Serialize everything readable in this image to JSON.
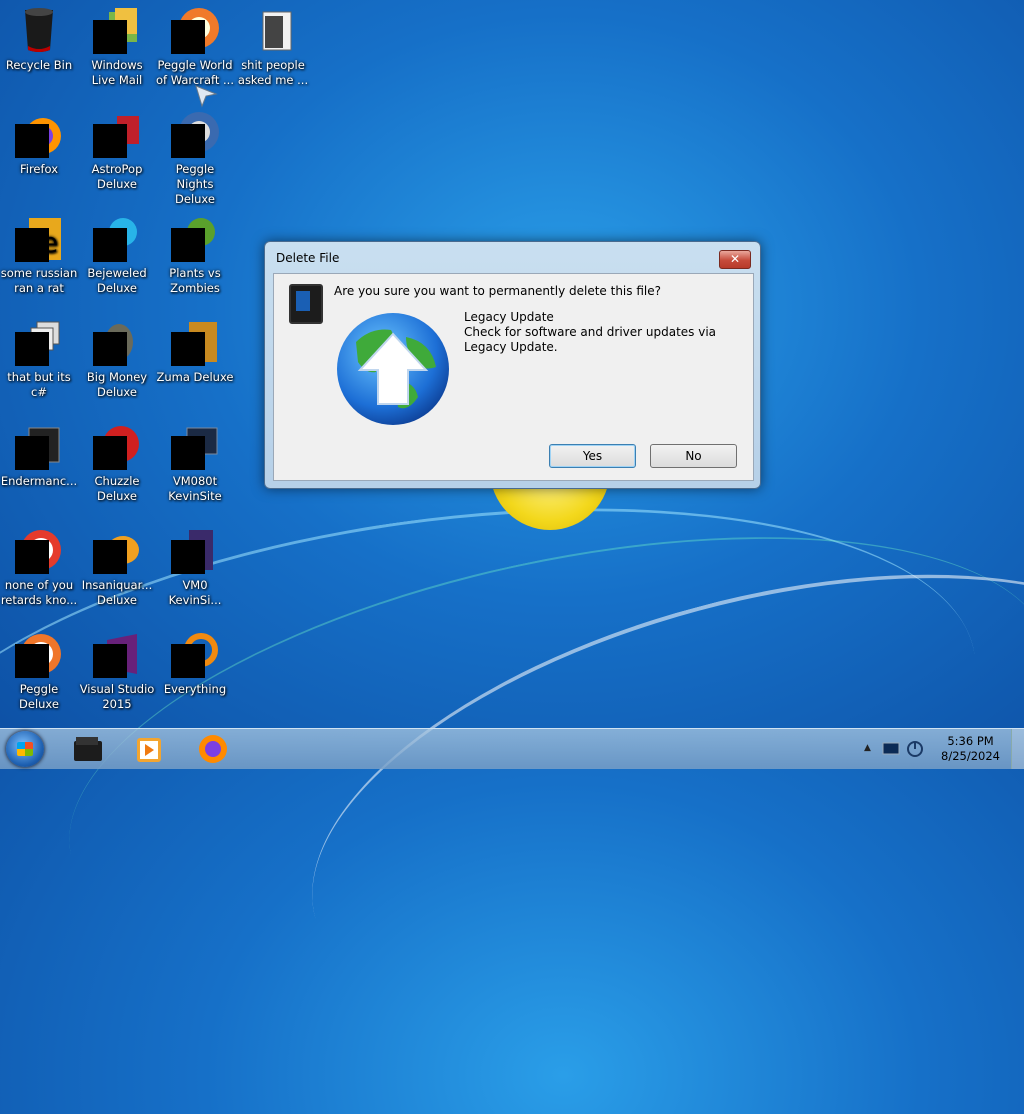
{
  "desktop_icons": [
    {
      "label": "Recycle Bin"
    },
    {
      "label": "Windows Live Mail"
    },
    {
      "label": "Peggle World of Warcraft ..."
    },
    {
      "label": "shit people asked me ..."
    },
    {
      "label": "Firefox"
    },
    {
      "label": "AstroPop Deluxe"
    },
    {
      "label": "Peggle Nights Deluxe"
    },
    {
      "label": "some russian ran a rat"
    },
    {
      "label": "Bejeweled Deluxe"
    },
    {
      "label": "Plants vs Zombies"
    },
    {
      "label": "that but its c#"
    },
    {
      "label": "Big Money Deluxe"
    },
    {
      "label": "Zuma Deluxe"
    },
    {
      "label": "Endermanc..."
    },
    {
      "label": "Chuzzle Deluxe"
    },
    {
      "label": "VM080t KevinSite"
    },
    {
      "label": "none of you retards kno..."
    },
    {
      "label": "Insaniquar... Deluxe"
    },
    {
      "label": "VM0 KevinSi..."
    },
    {
      "label": "Peggle Deluxe"
    },
    {
      "label": "Visual Studio 2015"
    },
    {
      "label": "Everything"
    }
  ],
  "dialog": {
    "title": "Delete File",
    "close_glyph": "✕",
    "question": "Are you sure you want to permanently delete this file?",
    "file_name": "Legacy Update",
    "file_description": "Check for software and driver updates via Legacy Update.",
    "yes_label": "Yes",
    "no_label": "No"
  },
  "taskbar": {
    "apps": [
      "file-explorer",
      "media-player",
      "firefox"
    ],
    "time": "5:36 PM",
    "date": "8/25/2024",
    "tray_icons": [
      "show-hidden-icons",
      "network-icon",
      "action-center-icon"
    ],
    "tray_expand_glyph": "▲"
  }
}
